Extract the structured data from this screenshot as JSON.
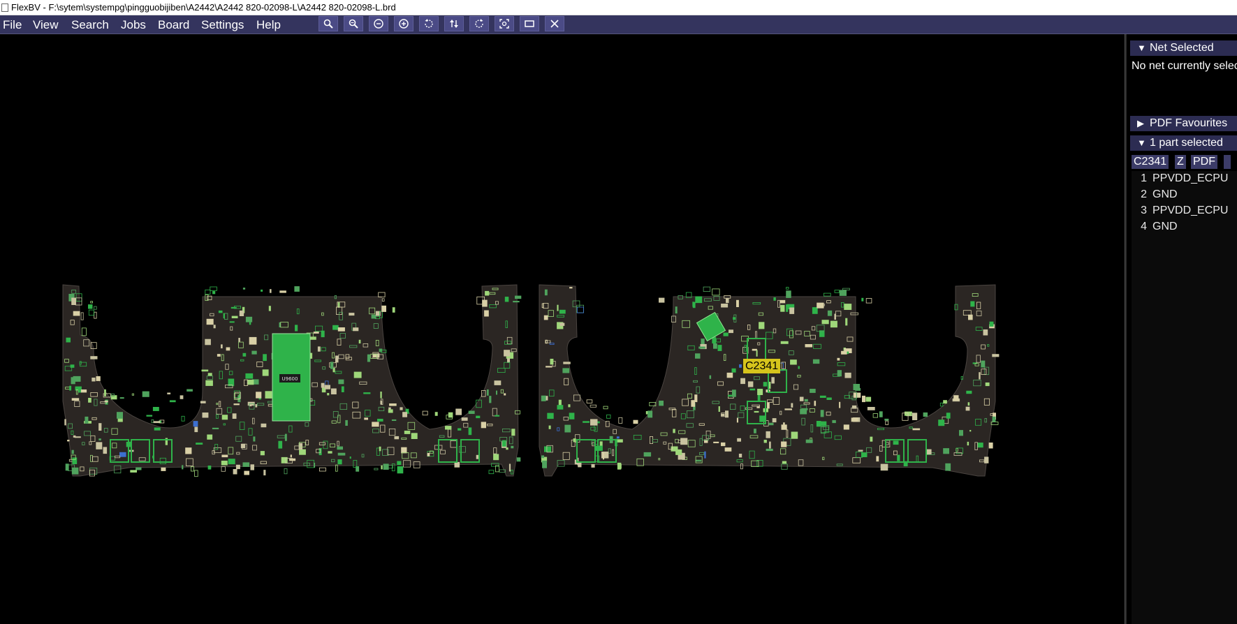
{
  "window": {
    "title": "FlexBV - F:\\sytem\\systempg\\pingguobijiben\\A2442\\A2442 820-02098-L\\A2442 820-02098-L.brd"
  },
  "menu": {
    "file": "File",
    "view": "View",
    "search": "Search",
    "jobs": "Jobs",
    "board": "Board",
    "settings": "Settings",
    "help": "Help"
  },
  "toolbar": [
    {
      "icon": "zoom-in-icon"
    },
    {
      "icon": "zoom-out-icon"
    },
    {
      "icon": "zoom-minus-icon"
    },
    {
      "icon": "zoom-plus-icon"
    },
    {
      "icon": "rotate-ccw-icon"
    },
    {
      "icon": "flip-icon"
    },
    {
      "icon": "rotate-cw-icon"
    },
    {
      "icon": "fit-screen-icon"
    },
    {
      "icon": "window-icon"
    },
    {
      "icon": "close-icon"
    }
  ],
  "board": {
    "selected_part_label": "C2341",
    "chip_text": "U9600"
  },
  "panel": {
    "net_selected": {
      "header": "Net Selected",
      "message": "No net currently selected"
    },
    "pdf_favourites": {
      "header": "PDF Favourites"
    },
    "parts": {
      "header": "1 part selected",
      "part_name": "C2341",
      "z_button": "Z",
      "pdf_button": "PDF",
      "pins": [
        {
          "num": "1",
          "net": "PPVDD_ECPU"
        },
        {
          "num": "2",
          "net": "GND"
        },
        {
          "num": "3",
          "net": "PPVDD_ECPU"
        },
        {
          "num": "4",
          "net": "GND"
        }
      ]
    }
  },
  "colors": {
    "menubar": "#34345e",
    "board": "#2b2623",
    "component_green": "#2fb34a",
    "component_cream": "#d9d0a6",
    "highlight": "#d6c41c"
  }
}
